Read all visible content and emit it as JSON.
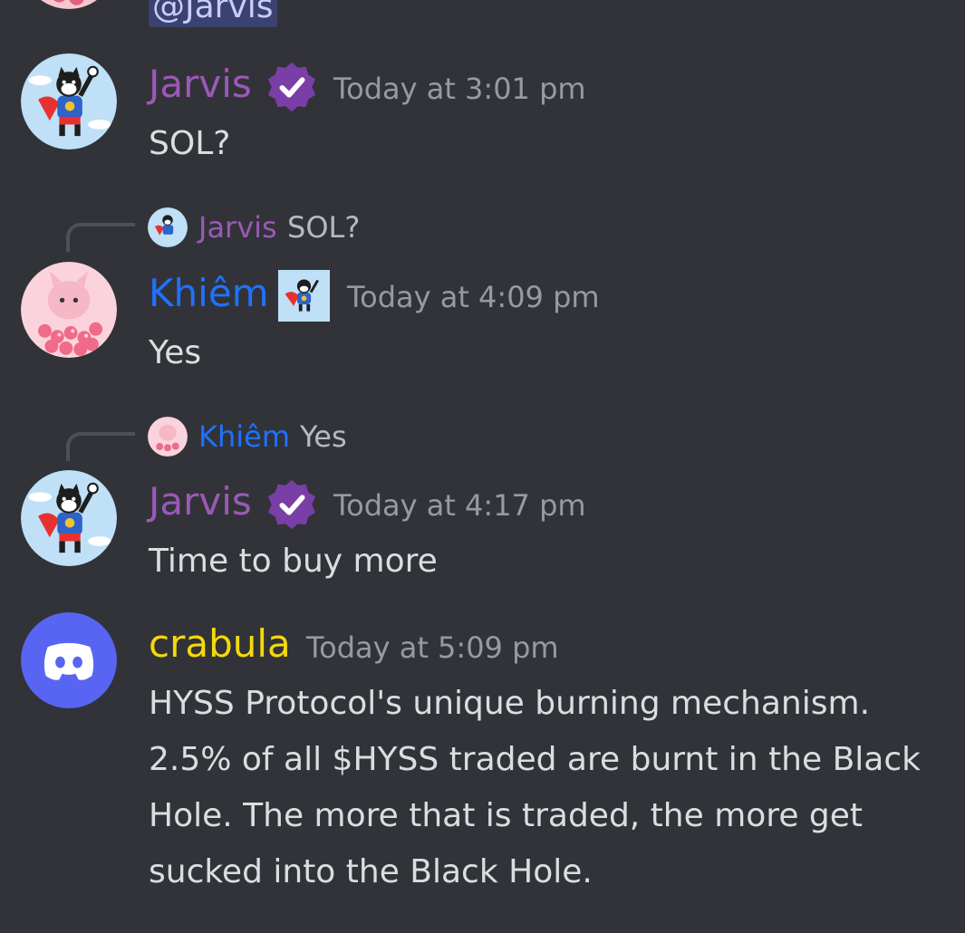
{
  "top": {
    "mention": "@Jarvis"
  },
  "colors": {
    "jarvis": "#9b59b6",
    "khiem": "#1e72ff",
    "crabula": "#f5d90a",
    "timestamp": "#949ba4",
    "background": "#313338",
    "discord_blurple": "#5865f2"
  },
  "messages": [
    {
      "author": "Jarvis",
      "author_icon": "verified-badge-icon",
      "timestamp": "Today at 3:01 pm",
      "lines": [
        "SOL?"
      ]
    },
    {
      "reply": {
        "author": "Jarvis",
        "text": "SOL?"
      },
      "author": "Khiêm",
      "author_icon": "cat-hero-badge-icon",
      "timestamp": "Today at 4:09 pm",
      "lines": [
        "Yes"
      ]
    },
    {
      "reply": {
        "author": "Khiêm",
        "text": "Yes"
      },
      "author": "Jarvis",
      "author_icon": "verified-badge-icon",
      "timestamp": "Today at 4:17 pm",
      "lines": [
        "Time to buy more"
      ]
    },
    {
      "author": "crabula",
      "timestamp": "Today at 5:09 pm",
      "lines": [
        "HYSS Protocol's unique burning mechanism.",
        "2.5% of all $HYSS traded are burnt in the Black",
        "Hole. The more that is traded, the more get",
        "sucked into the Black Hole."
      ]
    }
  ]
}
